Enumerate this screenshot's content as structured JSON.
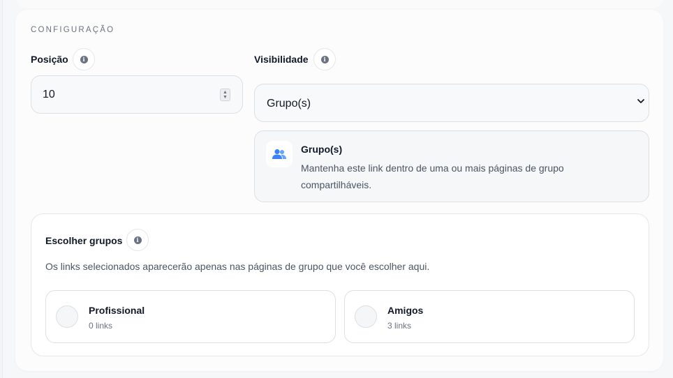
{
  "section": {
    "title": "CONFIGURAÇÃO"
  },
  "position": {
    "label": "Posição",
    "value": "10"
  },
  "visibility": {
    "label": "Visibilidade",
    "selected": "Grupo(s)",
    "description_title": "Grupo(s)",
    "description_text": "Mantenha este link dentro de uma ou mais páginas de grupo compartilháveis."
  },
  "choose_groups": {
    "title": "Escolher grupos",
    "subtitle": "Os links selecionados aparecerão apenas nas páginas de grupo que você escolher aqui.",
    "options": [
      {
        "name": "Profissional",
        "count": "0 links"
      },
      {
        "name": "Amigos",
        "count": "3 links"
      }
    ]
  },
  "icons": {
    "info": "info-icon",
    "group": "users-icon",
    "chevron": "chevron-down-icon"
  },
  "colors": {
    "accent": "#3b82f6",
    "border": "#dcdfe3",
    "muted": "#6b7280"
  }
}
